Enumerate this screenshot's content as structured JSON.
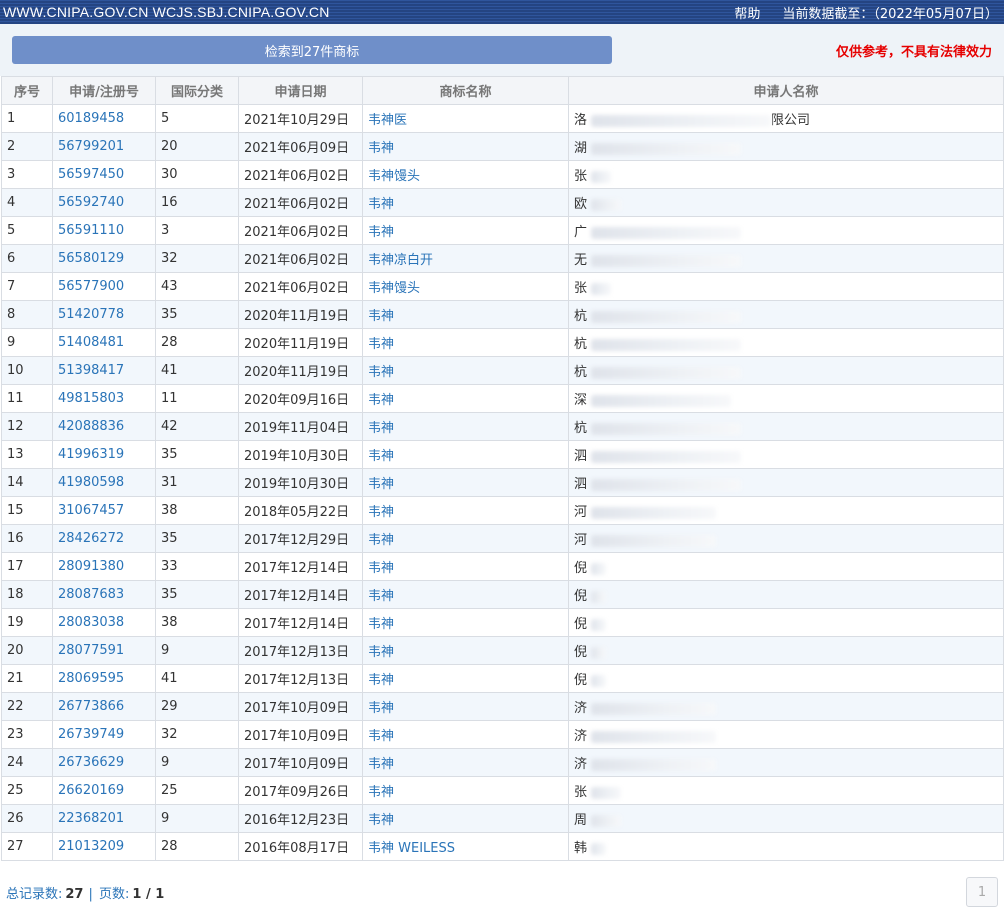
{
  "header": {
    "site_links": "WWW.CNIPA.GOV.CN WCJS.SBJ.CNIPA.GOV.CN",
    "help": "帮助",
    "data_date": "当前数据截至：（2022年05月07日）"
  },
  "toolbar": {
    "result_label": "检索到27件商标",
    "disclaimer": "仅供参考，不具有法律效力"
  },
  "table": {
    "columns": [
      "序号",
      "申请/注册号",
      "国际分类",
      "申请日期",
      "商标名称",
      "申请人名称"
    ],
    "rows": [
      {
        "no": "1",
        "reg": "60189458",
        "cls": "5",
        "date": "2021年10月29日",
        "name": "韦神医",
        "applicant": "洛",
        "suffix": "限公司"
      },
      {
        "no": "2",
        "reg": "56799201",
        "cls": "20",
        "date": "2021年06月09日",
        "name": "韦神",
        "applicant": "湖",
        "suffix": ""
      },
      {
        "no": "3",
        "reg": "56597450",
        "cls": "30",
        "date": "2021年06月02日",
        "name": "韦神馒头",
        "applicant": "张",
        "suffix": ""
      },
      {
        "no": "4",
        "reg": "56592740",
        "cls": "16",
        "date": "2021年06月02日",
        "name": "韦神",
        "applicant": "欧",
        "suffix": ""
      },
      {
        "no": "5",
        "reg": "56591110",
        "cls": "3",
        "date": "2021年06月02日",
        "name": "韦神",
        "applicant": "广",
        "suffix": ""
      },
      {
        "no": "6",
        "reg": "56580129",
        "cls": "32",
        "date": "2021年06月02日",
        "name": "韦神凉白开",
        "applicant": "无",
        "suffix": ""
      },
      {
        "no": "7",
        "reg": "56577900",
        "cls": "43",
        "date": "2021年06月02日",
        "name": "韦神馒头",
        "applicant": "张",
        "suffix": ""
      },
      {
        "no": "8",
        "reg": "51420778",
        "cls": "35",
        "date": "2020年11月19日",
        "name": "韦神",
        "applicant": "杭",
        "suffix": ""
      },
      {
        "no": "9",
        "reg": "51408481",
        "cls": "28",
        "date": "2020年11月19日",
        "name": "韦神",
        "applicant": "杭",
        "suffix": ""
      },
      {
        "no": "10",
        "reg": "51398417",
        "cls": "41",
        "date": "2020年11月19日",
        "name": "韦神",
        "applicant": "杭",
        "suffix": ""
      },
      {
        "no": "11",
        "reg": "49815803",
        "cls": "11",
        "date": "2020年09月16日",
        "name": "韦神",
        "applicant": "深",
        "suffix": ""
      },
      {
        "no": "12",
        "reg": "42088836",
        "cls": "42",
        "date": "2019年11月04日",
        "name": "韦神",
        "applicant": "杭",
        "suffix": ""
      },
      {
        "no": "13",
        "reg": "41996319",
        "cls": "35",
        "date": "2019年10月30日",
        "name": "韦神",
        "applicant": "泗",
        "suffix": ""
      },
      {
        "no": "14",
        "reg": "41980598",
        "cls": "31",
        "date": "2019年10月30日",
        "name": "韦神",
        "applicant": "泗",
        "suffix": ""
      },
      {
        "no": "15",
        "reg": "31067457",
        "cls": "38",
        "date": "2018年05月22日",
        "name": "韦神",
        "applicant": "河",
        "suffix": ""
      },
      {
        "no": "16",
        "reg": "28426272",
        "cls": "35",
        "date": "2017年12月29日",
        "name": "韦神",
        "applicant": "河",
        "suffix": ""
      },
      {
        "no": "17",
        "reg": "28091380",
        "cls": "33",
        "date": "2017年12月14日",
        "name": "韦神",
        "applicant": "倪",
        "suffix": ""
      },
      {
        "no": "18",
        "reg": "28087683",
        "cls": "35",
        "date": "2017年12月14日",
        "name": "韦神",
        "applicant": "倪",
        "suffix": ""
      },
      {
        "no": "19",
        "reg": "28083038",
        "cls": "38",
        "date": "2017年12月14日",
        "name": "韦神",
        "applicant": "倪",
        "suffix": ""
      },
      {
        "no": "20",
        "reg": "28077591",
        "cls": "9",
        "date": "2017年12月13日",
        "name": "韦神",
        "applicant": "倪",
        "suffix": ""
      },
      {
        "no": "21",
        "reg": "28069595",
        "cls": "41",
        "date": "2017年12月13日",
        "name": "韦神",
        "applicant": "倪",
        "suffix": ""
      },
      {
        "no": "22",
        "reg": "26773866",
        "cls": "29",
        "date": "2017年10月09日",
        "name": "韦神",
        "applicant": "济",
        "suffix": ""
      },
      {
        "no": "23",
        "reg": "26739749",
        "cls": "32",
        "date": "2017年10月09日",
        "name": "韦神",
        "applicant": "济",
        "suffix": ""
      },
      {
        "no": "24",
        "reg": "26736629",
        "cls": "9",
        "date": "2017年10月09日",
        "name": "韦神",
        "applicant": "济",
        "suffix": ""
      },
      {
        "no": "25",
        "reg": "26620169",
        "cls": "25",
        "date": "2017年09月26日",
        "name": "韦神",
        "applicant": "张",
        "suffix": ""
      },
      {
        "no": "26",
        "reg": "22368201",
        "cls": "9",
        "date": "2016年12月23日",
        "name": "韦神",
        "applicant": "周",
        "suffix": ""
      },
      {
        "no": "27",
        "reg": "21013209",
        "cls": "28",
        "date": "2016年08月17日",
        "name": "韦神 WEILESS",
        "applicant": "韩",
        "suffix": ""
      }
    ]
  },
  "footer": {
    "total_label": "总记录数:",
    "total_value": "27",
    "separator": "|",
    "pages_label": "页数:",
    "pages_value": "1 / 1",
    "page_button": "1"
  },
  "colors": {
    "topbar": "#2b4d8f",
    "link": "#2a74b8",
    "disclaimer": "#e60000",
    "result_button": "#6f8fc9"
  }
}
